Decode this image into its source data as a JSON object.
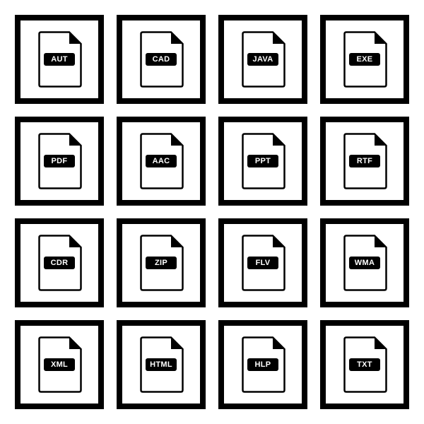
{
  "icons": [
    {
      "label": "AUT"
    },
    {
      "label": "CAD"
    },
    {
      "label": "JAVA"
    },
    {
      "label": "EXE"
    },
    {
      "label": "PDF"
    },
    {
      "label": "AAC"
    },
    {
      "label": "PPT"
    },
    {
      "label": "RTF"
    },
    {
      "label": "CDR"
    },
    {
      "label": "ZIP"
    },
    {
      "label": "FLV"
    },
    {
      "label": "WMA"
    },
    {
      "label": "XML"
    },
    {
      "label": "HTML"
    },
    {
      "label": "HLP"
    },
    {
      "label": "TXT"
    }
  ],
  "colors": {
    "foreground": "#000000",
    "background": "#ffffff"
  }
}
